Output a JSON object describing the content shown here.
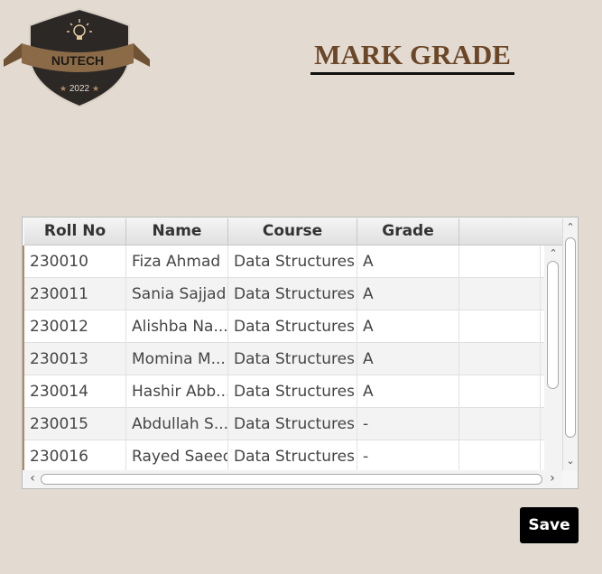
{
  "logo": {
    "name": "NUTECH",
    "year": "2022"
  },
  "page": {
    "title": "MARK GRADE"
  },
  "table": {
    "columns": [
      "Roll No",
      "Name",
      "Course",
      "Grade",
      ""
    ],
    "rows": [
      [
        "230010",
        "Fiza Ahmad",
        "Data Structures",
        "A",
        ""
      ],
      [
        "230011",
        "Sania Sajjad",
        "Data Structures",
        "A",
        ""
      ],
      [
        "230012",
        "Alishba Na...",
        "Data Structures",
        "A",
        ""
      ],
      [
        "230013",
        "Momina M...",
        "Data Structures",
        "A",
        ""
      ],
      [
        "230014",
        "Hashir Abb...",
        "Data Structures",
        "A",
        ""
      ],
      [
        "230015",
        "Abdullah S...",
        "Data Structures",
        "-",
        ""
      ],
      [
        "230016",
        "Rayed Saeed",
        "Data Structures",
        "-",
        ""
      ]
    ]
  },
  "actions": {
    "save_label": "Save"
  },
  "colors": {
    "background": "#e3dbd1",
    "title": "#6b4627",
    "banner": "#8b6b47",
    "shield": "#2b2826"
  }
}
